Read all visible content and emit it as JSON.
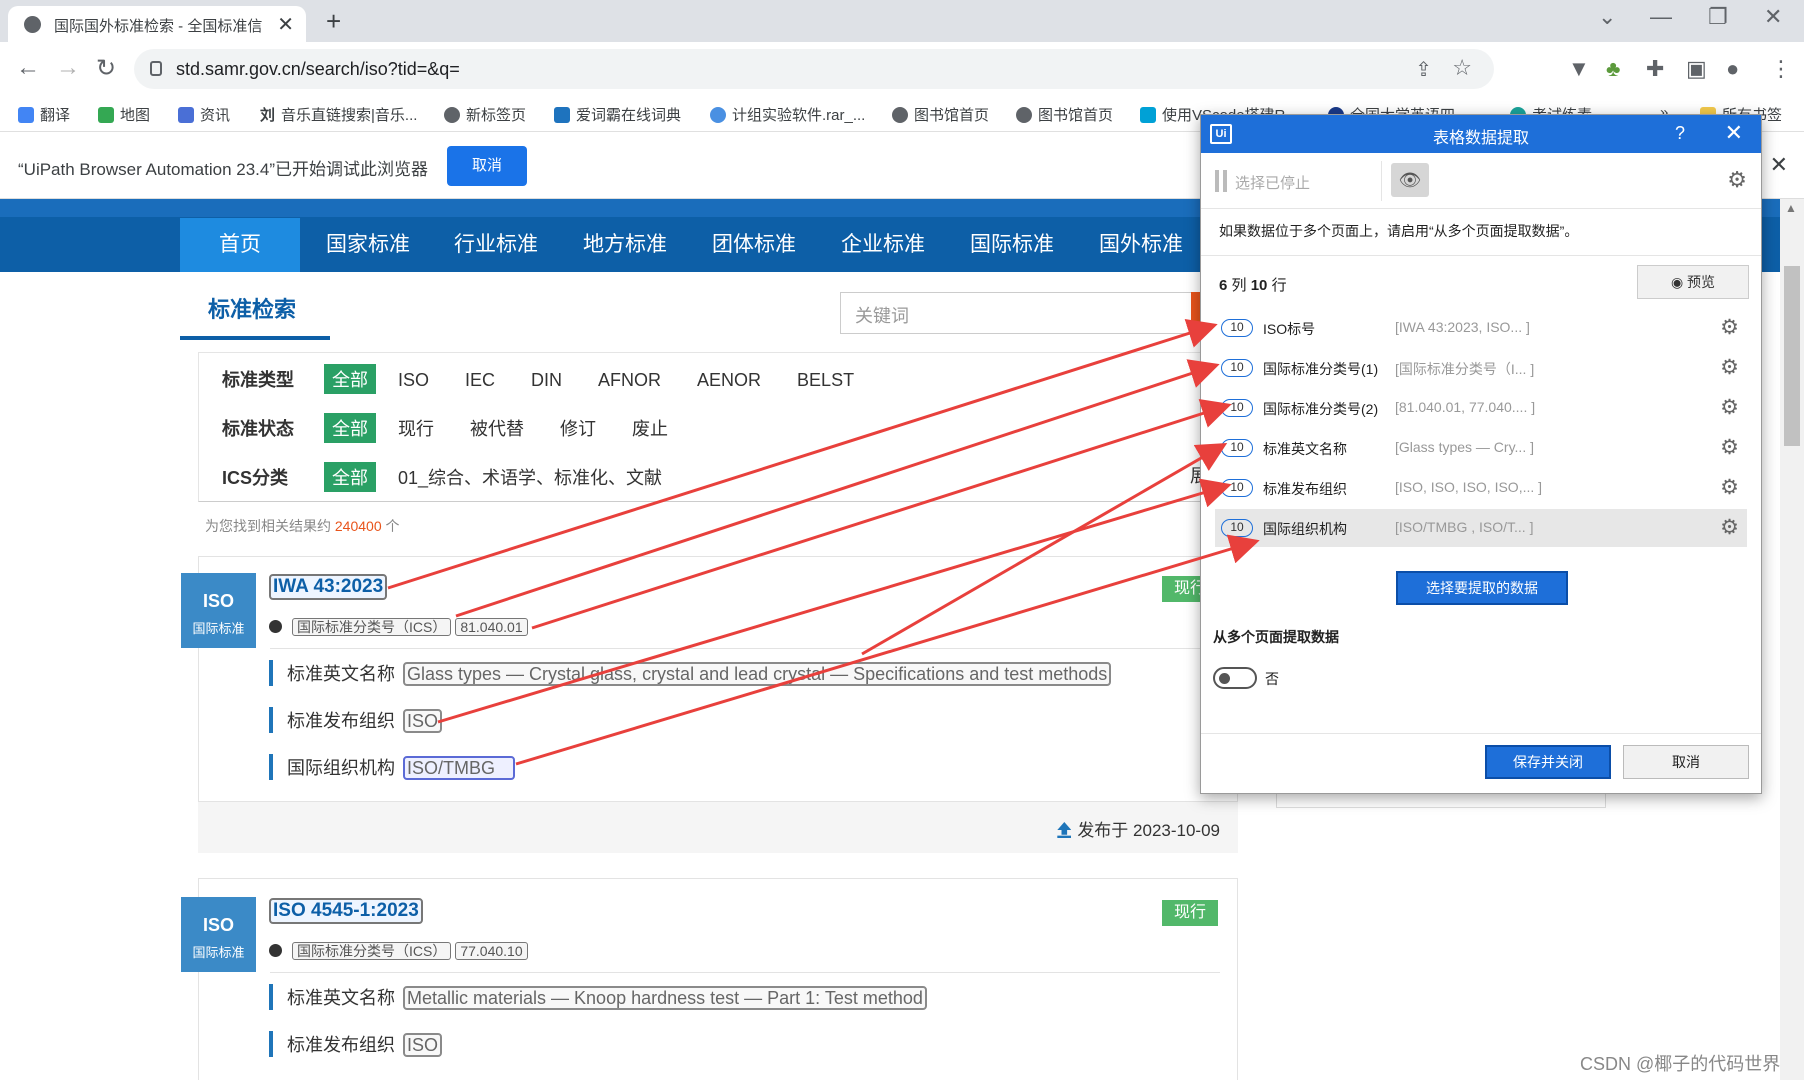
{
  "browser": {
    "tab_title": "国际国外标准检索 - 全国标准信",
    "url": "std.samr.gov.cn/search/iso?tid=&q=",
    "bookmarks": [
      "翻译",
      "地图",
      "资讯",
      "音乐直链搜索|音乐...",
      "新标签页",
      "爱词霸在线词典",
      "计组实验软件.rar_...",
      "图书馆首页",
      "图书馆首页",
      "使用VScode搭建R...",
      "全国大学英语四...",
      "考试练素...",
      "所有书签"
    ],
    "bookmark_icon_char": "刘",
    "infobar_message": "“UiPath Browser Automation 23.4”已开始调试此浏览器",
    "infobar_button": "取消"
  },
  "page": {
    "nav": [
      "首页",
      "国家标准",
      "行业标准",
      "地方标准",
      "团体标准",
      "企业标准",
      "国际标准",
      "国外标准"
    ],
    "search_title": "标准检索",
    "search_placeholder": "关键词",
    "filters": [
      {
        "label": "标准类型",
        "active": "全部",
        "options": [
          "ISO",
          "IEC",
          "DIN",
          "AFNOR",
          "AENOR",
          "BELST"
        ]
      },
      {
        "label": "标准状态",
        "active": "全部",
        "options": [
          "现行",
          "被代替",
          "修订",
          "废止"
        ]
      },
      {
        "label": "ICS分类",
        "active": "全部",
        "options": [
          "01_综合、术语学、标准化、文献"
        ],
        "trail": "展"
      }
    ],
    "found_prefix": "为您找到相关结果约",
    "found_count": "240400",
    "found_suffix": "个",
    "results": [
      {
        "badge_top": "ISO",
        "badge_bottom": "国际标准",
        "number": "IWA 43:2023",
        "status": "现行",
        "ics_label": "国际标准分类号（ICS）",
        "ics_value": "81.040.01",
        "fields": [
          {
            "label": "标准英文名称",
            "value": "Glass types — Crystal glass, crystal and lead crystal — Specifications and test methods"
          },
          {
            "label": "标准发布组织",
            "value": "ISO"
          },
          {
            "label": "国际组织机构",
            "value": "ISO/TMBG"
          }
        ],
        "published": "发布于 2023-10-09"
      },
      {
        "badge_top": "ISO",
        "badge_bottom": "国际标准",
        "number": "ISO 4545-1:2023",
        "status": "现行",
        "ics_label": "国际标准分类号（ICS）",
        "ics_value": "77.040.10",
        "fields": [
          {
            "label": "标准英文名称",
            "value": "Metallic materials — Knoop hardness test — Part 1: Test method"
          },
          {
            "label": "标准发布组织",
            "value": "ISO"
          }
        ]
      }
    ]
  },
  "dialog": {
    "title": "表格数据提取",
    "help": "?",
    "paused_label": "选择已停止",
    "hint": "如果数据位于多个页面上，请启用“从多个页面提取数据”。",
    "count_cols": "6",
    "count_cols_unit": "列",
    "count_rows": "10",
    "count_rows_unit": "行",
    "preview_label": "预览",
    "columns": [
      {
        "count": "10",
        "name": "ISO标号",
        "sample": "[IWA 43:2023, ISO... ]"
      },
      {
        "count": "10",
        "name": "国际标准分类号(1)",
        "sample": "[国际标准分类号（I... ]"
      },
      {
        "count": "10",
        "name": "国际标准分类号(2)",
        "sample": "[81.040.01, 77.040.... ]"
      },
      {
        "count": "10",
        "name": "标准英文名称",
        "sample": "[Glass types — Cry... ]"
      },
      {
        "count": "10",
        "name": "标准发布组织",
        "sample": "[ISO, ISO, ISO, ISO,... ]"
      },
      {
        "count": "10",
        "name": "国际组织机构",
        "sample": "[ISO/TMBG , ISO/T... ]"
      }
    ],
    "select_button": "选择要提取的数据",
    "multi_page_label": "从多个页面提取数据",
    "toggle_label": "否",
    "save_button": "保存并关闭",
    "cancel_button": "取消"
  },
  "watermark": "CSDN @椰子的代码世界",
  "colors": {
    "nav_bg": "#0d5fa7",
    "accent": "#1e6fd9",
    "status_green": "#52b86a",
    "arrow": "#e8403c"
  }
}
